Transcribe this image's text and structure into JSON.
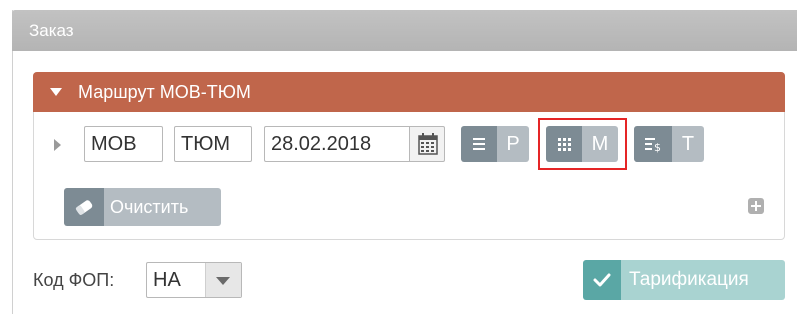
{
  "panel": {
    "title": "Заказ"
  },
  "route": {
    "title": "Маршрут МОВ-ТЮМ",
    "from": "МОВ",
    "to": "ТЮМ",
    "date": "28.02.2018",
    "modes": [
      {
        "icon": "list-icon",
        "letter": "Р"
      },
      {
        "icon": "grid-icon",
        "letter": "М",
        "highlighted": true
      },
      {
        "icon": "price-list-icon",
        "letter": "Т"
      }
    ],
    "clear_label": "Очистить"
  },
  "footer": {
    "fop_label": "Код ФОП:",
    "fop_value": "НА",
    "tariff_label": "Тарификация"
  },
  "colors": {
    "route_header": "#c0664b",
    "panel_header": "#b8b8b8",
    "button_dark": "#7d8b94",
    "button_light": "#b4bcc2",
    "tariff_dark": "#5aa7a5",
    "tariff_light": "#a9d3d1",
    "highlight": "#e52526"
  }
}
